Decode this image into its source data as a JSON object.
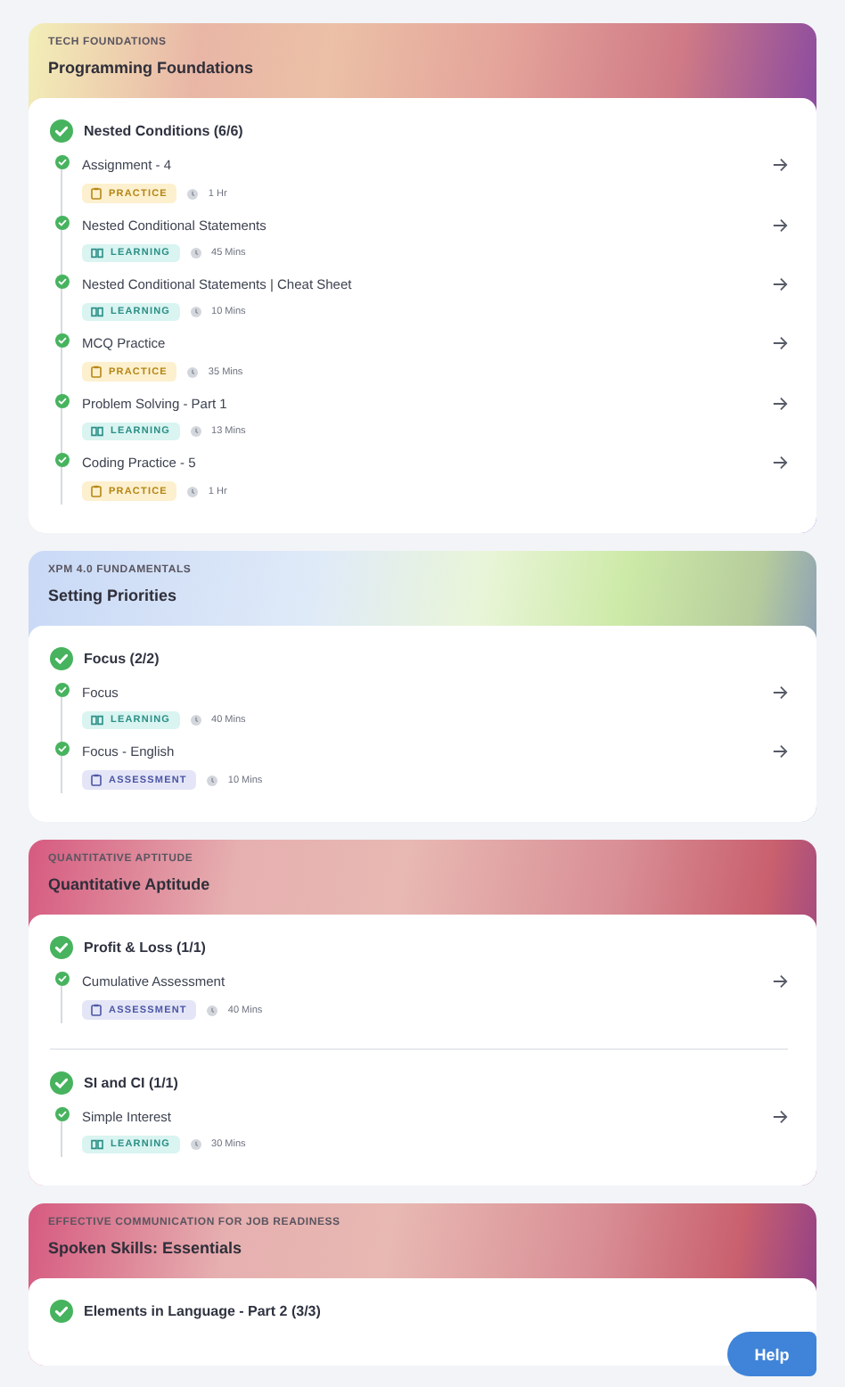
{
  "courses": [
    {
      "kind": "warm",
      "category": "TECH FOUNDATIONS",
      "title": "Programming Foundations",
      "groups": [
        {
          "title": "Nested Conditions (6/6)",
          "completed": true,
          "items": [
            {
              "title": "Assignment - 4",
              "kind": "practice",
              "badge": "PRACTICE",
              "duration": "1 Hr",
              "completed": true
            },
            {
              "title": "Nested Conditional Statements",
              "kind": "learning",
              "badge": "LEARNING",
              "duration": "45 Mins",
              "completed": true
            },
            {
              "title": "Nested Conditional Statements | Cheat Sheet",
              "kind": "learning",
              "badge": "LEARNING",
              "duration": "10 Mins",
              "completed": true
            },
            {
              "title": "MCQ Practice",
              "kind": "practice",
              "badge": "PRACTICE",
              "duration": "35 Mins",
              "completed": true
            },
            {
              "title": "Problem Solving - Part 1",
              "kind": "learning",
              "badge": "LEARNING",
              "duration": "13 Mins",
              "completed": true
            },
            {
              "title": "Coding Practice - 5",
              "kind": "practice",
              "badge": "PRACTICE",
              "duration": "1 Hr",
              "completed": true
            }
          ]
        }
      ]
    },
    {
      "kind": "cool",
      "category": "XPM 4.0 FUNDAMENTALS",
      "title": "Setting Priorities",
      "groups": [
        {
          "title": "Focus (2/2)",
          "completed": true,
          "items": [
            {
              "title": "Focus",
              "kind": "learning",
              "badge": "LEARNING",
              "duration": "40 Mins",
              "completed": true
            },
            {
              "title": "Focus - English",
              "kind": "assessment",
              "badge": "ASSESSMENT",
              "duration": "10 Mins",
              "completed": true
            }
          ]
        }
      ]
    },
    {
      "kind": "rose",
      "category": "QUANTITATIVE APTITUDE",
      "title": "Quantitative Aptitude",
      "groups": [
        {
          "title": "Profit & Loss (1/1)",
          "completed": true,
          "items": [
            {
              "title": "Cumulative Assessment",
              "kind": "assessment",
              "badge": "ASSESSMENT",
              "duration": "40 Mins",
              "completed": true
            }
          ]
        },
        {
          "title": "SI and CI (1/1)",
          "completed": true,
          "items": [
            {
              "title": "Simple Interest",
              "kind": "learning",
              "badge": "LEARNING",
              "duration": "30 Mins",
              "completed": true
            }
          ]
        }
      ]
    },
    {
      "kind": "rose",
      "category": "EFFECTIVE COMMUNICATION FOR JOB READINESS",
      "title": "Spoken Skills: Essentials",
      "groups": [
        {
          "title": "Elements in Language - Part 2 (3/3)",
          "completed": true
        }
      ]
    }
  ],
  "help_button": "Help"
}
